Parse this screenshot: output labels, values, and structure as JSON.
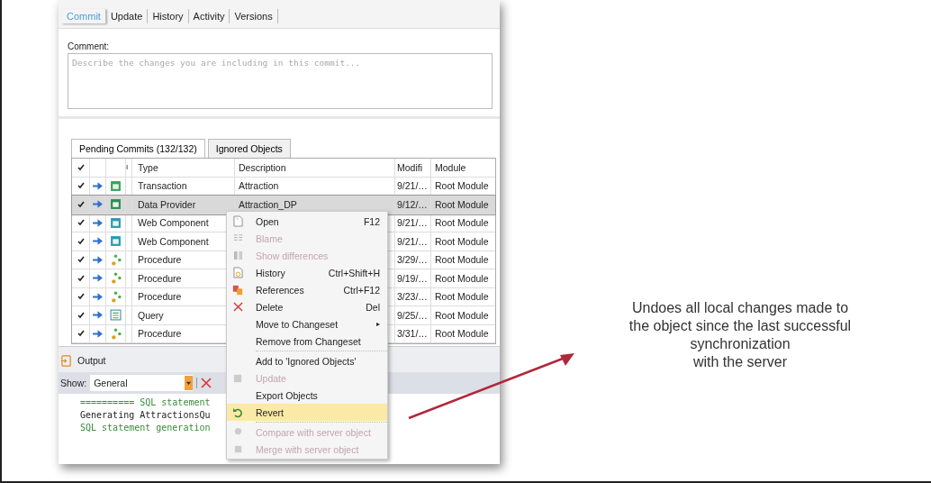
{
  "tabs": [
    {
      "label": "Commit",
      "selected": true
    },
    {
      "label": "Update",
      "selected": false
    },
    {
      "label": "History",
      "selected": false
    },
    {
      "label": "Activity",
      "selected": false
    },
    {
      "label": "Versions",
      "selected": false
    }
  ],
  "comment": {
    "label": "Comment:",
    "placeholder": "Describe the changes you are including in this commit..."
  },
  "list_tabs": [
    {
      "label": "Pending Commits (132/132)",
      "selected": true
    },
    {
      "label": "Ignored Objects",
      "selected": false
    }
  ],
  "table": {
    "header_checked": true,
    "columns": [
      "I",
      "Type",
      "Description",
      "Modifi",
      "Module"
    ],
    "rows": [
      {
        "checked": true,
        "selected": false,
        "kind": "transaction",
        "type": "Transaction",
        "description": "Attraction",
        "modified": "9/21/…",
        "module": "Root Module"
      },
      {
        "checked": true,
        "selected": true,
        "kind": "data-provider",
        "type": "Data Provider",
        "description": "Attraction_DP",
        "modified": "9/12/…",
        "module": "Root Module"
      },
      {
        "checked": true,
        "selected": false,
        "kind": "web-component",
        "type": "Web Component",
        "modified": "9/21/…",
        "module": "Root Module"
      },
      {
        "checked": true,
        "selected": false,
        "kind": "web-component",
        "type": "Web Component",
        "modified": "9/21/…",
        "module": "Root Module"
      },
      {
        "checked": true,
        "selected": false,
        "kind": "procedure",
        "type": "Procedure",
        "modified": "3/29/…",
        "module": "Root Module"
      },
      {
        "checked": true,
        "selected": false,
        "kind": "procedure",
        "type": "Procedure",
        "modified": "9/19/…",
        "module": "Root Module"
      },
      {
        "checked": true,
        "selected": false,
        "kind": "procedure",
        "type": "Procedure",
        "modified": "3/23/…",
        "module": "Root Module"
      },
      {
        "checked": true,
        "selected": false,
        "kind": "query",
        "type": "Query",
        "modified": "9/25/…",
        "module": "Root Module"
      },
      {
        "checked": true,
        "selected": false,
        "kind": "procedure",
        "type": "Procedure",
        "modified": "3/31/…",
        "module": "Root Module"
      }
    ]
  },
  "output": {
    "title": "Output",
    "show_label": "Show:",
    "show_value": "General",
    "lines": [
      {
        "text": "========== SQL statement",
        "kind": "info"
      },
      {
        "text": "Generating AttractionsQu",
        "kind": "plain"
      },
      {
        "text": "SQL statement generation",
        "kind": "info"
      }
    ]
  },
  "context_menu": [
    {
      "label": "Open",
      "shortcut": "F12",
      "disabled": false,
      "selected": false
    },
    {
      "label": "Blame",
      "disabled": true,
      "selected": false
    },
    {
      "label": "Show differences",
      "disabled": true,
      "selected": false
    },
    {
      "label": "History",
      "shortcut": "Ctrl+Shift+H",
      "disabled": false,
      "selected": false
    },
    {
      "label": "References",
      "shortcut": "Ctrl+F12",
      "disabled": false,
      "selected": false
    },
    {
      "label": "Delete",
      "shortcut": "Del",
      "disabled": false,
      "selected": false
    },
    {
      "label": "Move to Changeset",
      "submenu": "▸",
      "disabled": false,
      "selected": false
    },
    {
      "label": "Remove from Changeset",
      "disabled": false,
      "selected": false
    },
    {
      "label": "Add to 'Ignored Objects'",
      "separator_before": true,
      "disabled": false,
      "selected": false
    },
    {
      "label": "Update",
      "disabled": true,
      "selected": false
    },
    {
      "label": "Export Objects",
      "disabled": false,
      "selected": false
    },
    {
      "label": "Revert",
      "disabled": false,
      "selected": true
    },
    {
      "label": "Compare with server object",
      "separator_before": true,
      "disabled": true,
      "selected": false
    },
    {
      "label": "Merge with server object",
      "disabled": true,
      "selected": false
    }
  ],
  "annotation": {
    "lines": [
      "Undoes all local changes made to",
      "the object since the last successful",
      "synchronization",
      "with the server"
    ]
  }
}
